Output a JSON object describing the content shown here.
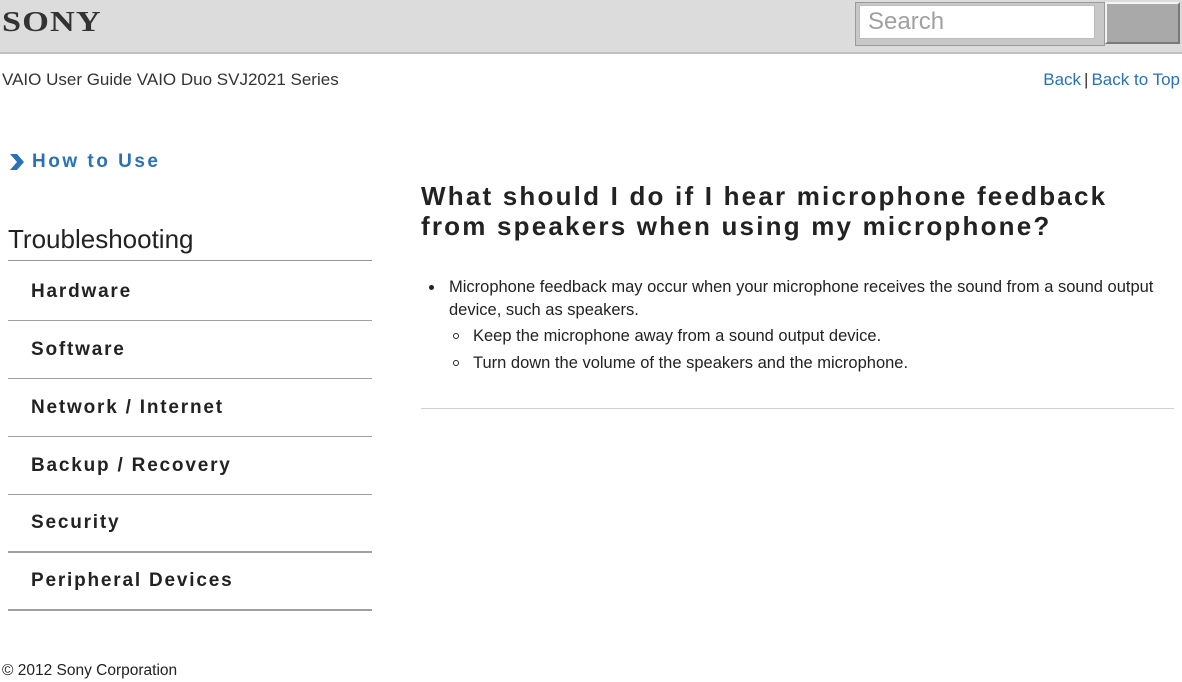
{
  "header": {
    "logo": "SONY",
    "search": {
      "placeholder": "Search",
      "value": ""
    },
    "search_button_label": ""
  },
  "subheader": {
    "title": "VAIO User Guide VAIO Duo SVJ2021 Series",
    "links": {
      "back": "Back",
      "separator": "|",
      "back_to_top": "Back to Top"
    }
  },
  "sidebar": {
    "how_to_use": "How to Use",
    "section_title": "Troubleshooting",
    "items": [
      {
        "label": "Hardware"
      },
      {
        "label": "Software"
      },
      {
        "label": "Network / Internet"
      },
      {
        "label": "Backup / Recovery"
      },
      {
        "label": "Security"
      },
      {
        "label": "Peripheral Devices"
      }
    ]
  },
  "main": {
    "title": "What should I do if I hear microphone feedback from speakers when using my microphone?",
    "bullets": [
      {
        "text": "Microphone feedback may occur when your microphone receives the sound from a sound output device, such as speakers.",
        "sub": [
          "Keep the microphone away from a sound output device.",
          "Turn down the volume of the speakers and the microphone."
        ]
      }
    ]
  },
  "footer": {
    "copyright": "© 2012 Sony Corporation"
  },
  "colors": {
    "link": "#2a72b8",
    "header_bg": "#dcdcdc",
    "search_button": "#a9a9a9"
  }
}
